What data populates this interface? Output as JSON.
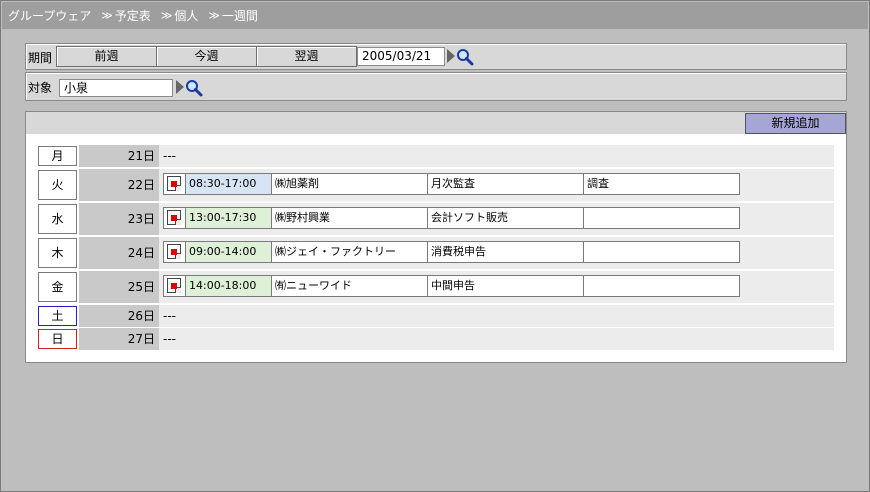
{
  "header": {
    "app": "グループウェア",
    "crumbs": [
      "予定表",
      "個人",
      "一週間"
    ],
    "sep": "≫"
  },
  "period": {
    "label": "期間",
    "prev_week": "前週",
    "this_week": "今週",
    "next_week": "翌週",
    "date_value": "2005/03/21"
  },
  "target": {
    "label": "対象",
    "value": "小泉"
  },
  "main": {
    "add_label": "新規追加",
    "days": [
      {
        "day": "月",
        "date": "21日",
        "dash": "---"
      },
      {
        "day": "火",
        "date": "22日",
        "time": "08:30-17:00",
        "client": "㈱旭薬剤",
        "item": "月次監査",
        "note": "調査",
        "time_bg": "#d6e4f4"
      },
      {
        "day": "水",
        "date": "23日",
        "time": "13:00-17:30",
        "client": "㈱野村興業",
        "item": "会計ソフト販売",
        "note": "",
        "time_bg": "#def0d8"
      },
      {
        "day": "木",
        "date": "24日",
        "time": "09:00-14:00",
        "client": "㈱ジェイ・ファクトリー",
        "item": "消費税申告",
        "note": "",
        "time_bg": "#def0d8"
      },
      {
        "day": "金",
        "date": "25日",
        "time": "14:00-18:00",
        "client": "㈲ニューワイド",
        "item": "中間申告",
        "note": "",
        "time_bg": "#def0d8"
      },
      {
        "day": "土",
        "date": "26日",
        "dash": "---",
        "day_border": "#2020c0"
      },
      {
        "day": "日",
        "date": "27日",
        "dash": "---",
        "day_border": "#d02020"
      }
    ]
  }
}
